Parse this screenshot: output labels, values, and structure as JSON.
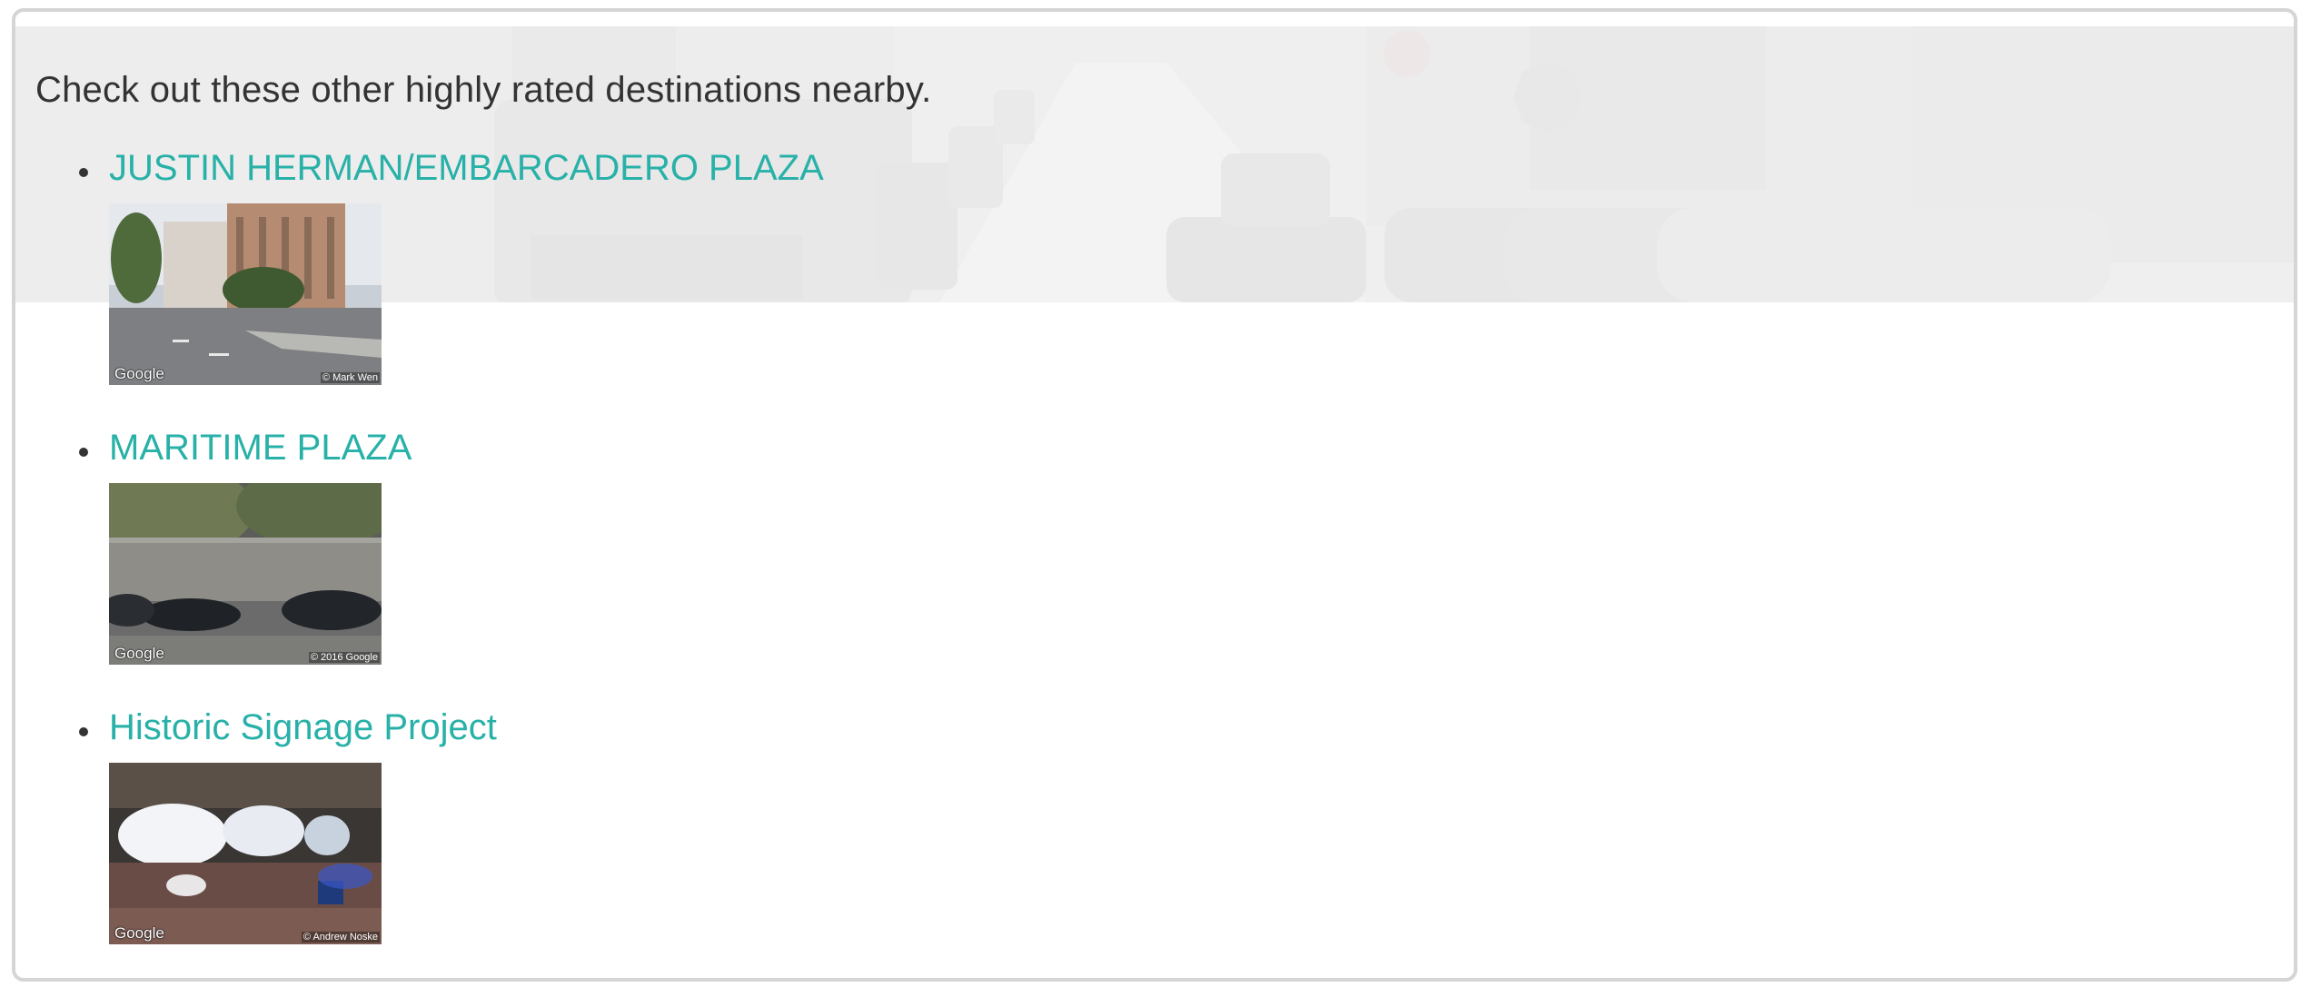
{
  "intro_text": "Check out these other highly rated destinations nearby.",
  "colors": {
    "link": "#28b1a8",
    "text": "#333333",
    "border": "#d5d5d5"
  },
  "destinations": [
    {
      "name": "JUSTIN HERMAN/EMBARCADERO PLAZA",
      "image_brand": "Google",
      "image_credit": "© Mark Wen"
    },
    {
      "name": "MARITIME PLAZA",
      "image_brand": "Google",
      "image_credit": "© 2016 Google"
    },
    {
      "name": "Historic Signage Project",
      "image_brand": "Google",
      "image_credit": "© Andrew Noske"
    }
  ]
}
